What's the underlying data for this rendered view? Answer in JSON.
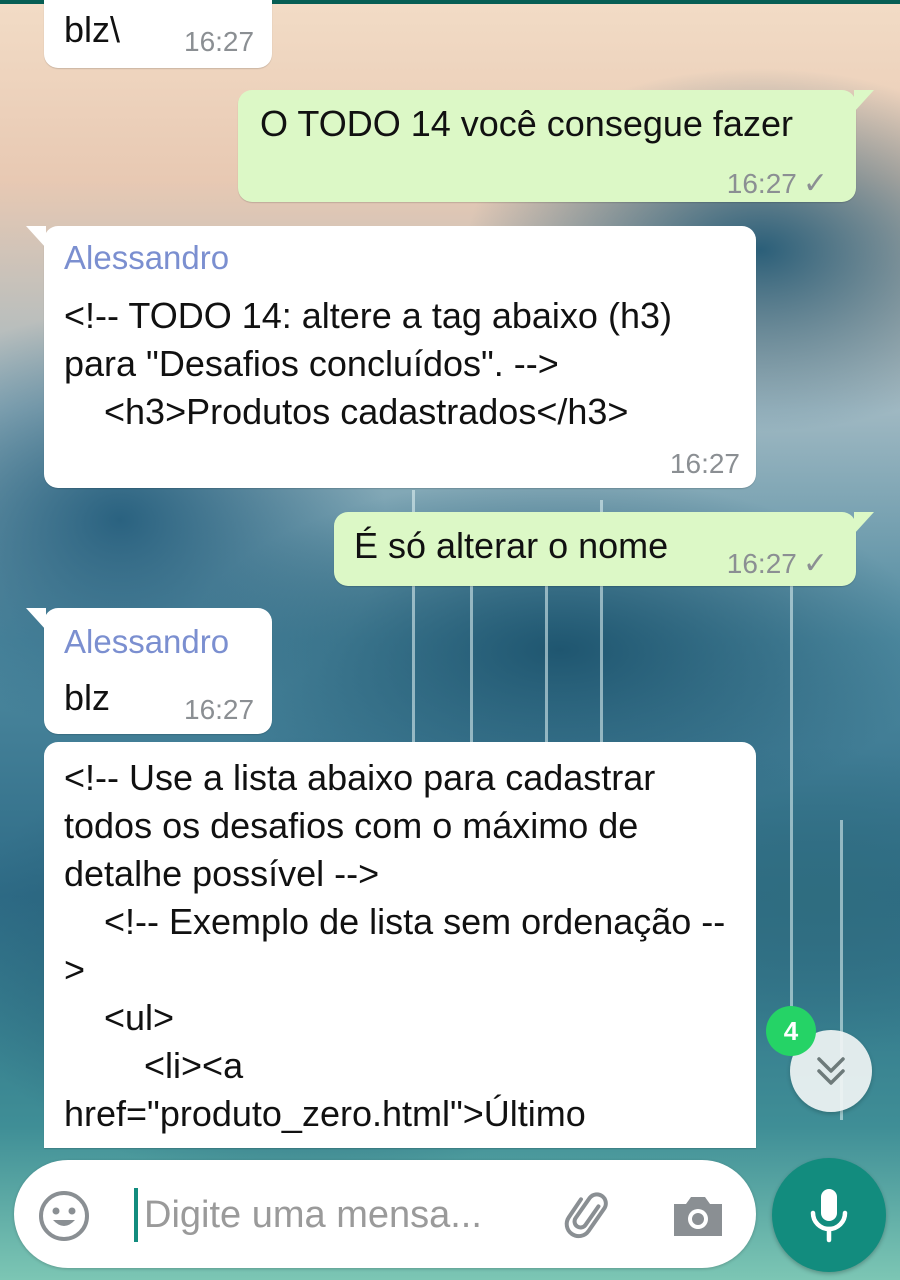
{
  "messages": [
    {
      "type": "in",
      "text": "blz\\",
      "time": "16:27"
    },
    {
      "type": "out",
      "text": "O TODO 14 você consegue fazer",
      "time": "16:27",
      "status": "✓"
    },
    {
      "type": "in",
      "sender": "Alessandro",
      "text": "<!-- TODO 14: altere a tag abaixo (h3) para \"Desafios concluídos\". -->\n    <h3>Produtos cadastrados</h3>",
      "time": "16:27"
    },
    {
      "type": "out",
      "text": "É só alterar o nome",
      "time": "16:27",
      "status": "✓"
    },
    {
      "type": "in",
      "sender": "Alessandro",
      "text": "blz",
      "time": "16:27"
    },
    {
      "type": "in",
      "text": "<!-- Use a lista abaixo para cadastrar todos os desafios com o máximo de detalhe possível -->\n    <!-- Exemplo de lista sem ordenação -->\n    <ul>\n        <li><a href=\"produto_zero.html\">Último smartphone V.I.P.A</a></li>"
    }
  ],
  "unread_count": "4",
  "composer": {
    "placeholder": "Digite uma mensa..."
  },
  "icons": {
    "emoji": "emoji-icon",
    "attach": "paperclip-icon",
    "camera": "camera-icon",
    "mic": "microphone-icon",
    "scroll": "double-chevron-down-icon"
  },
  "colors": {
    "header": "#075e54",
    "outgoing": "#dcf8c6",
    "incoming": "#ffffff",
    "accent": "#128c7e",
    "badge": "#25d366",
    "sender": "#7b8fd0"
  }
}
